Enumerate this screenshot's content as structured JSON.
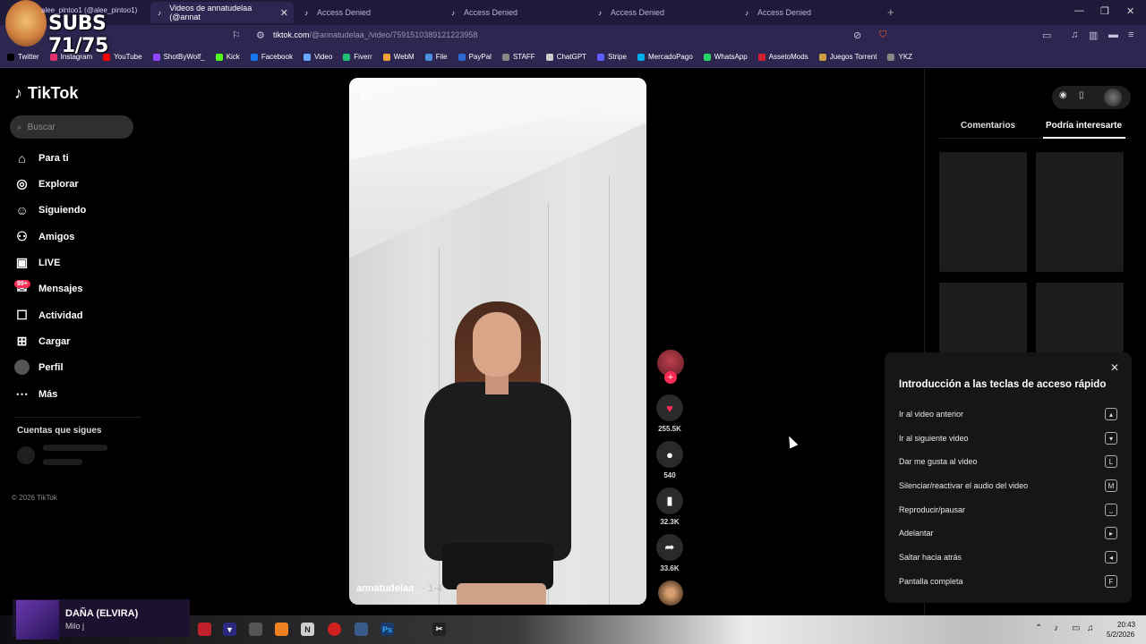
{
  "browser": {
    "tabs": [
      {
        "label": "Videos de annatudelaa (@annat"
      },
      {
        "label": "Access Denied"
      },
      {
        "label": "Access Denied"
      },
      {
        "label": "Access Denied"
      },
      {
        "label": "Access Denied"
      }
    ],
    "url_domain": "tiktok.com",
    "url_path": "/@annatudelaa_/video/7591510389121223958",
    "bookmarks": [
      {
        "label": "Twitter",
        "color": "#000000"
      },
      {
        "label": "Instagram",
        "color": "#e1306c"
      },
      {
        "label": "YouTube",
        "color": "#ff0000"
      },
      {
        "label": "ShotByWolf_",
        "color": "#9146ff"
      },
      {
        "label": "Kick",
        "color": "#53fc18"
      },
      {
        "label": "Facebook",
        "color": "#1877f2"
      },
      {
        "label": "Video",
        "color": "#6aa8ff"
      },
      {
        "label": "Fiverr",
        "color": "#1dbf73"
      },
      {
        "label": "WebM",
        "color": "#f2a33a"
      },
      {
        "label": "File",
        "color": "#4a90e2"
      },
      {
        "label": "PayPal",
        "color": "#2a6ad0"
      },
      {
        "label": "STAFF",
        "color": "#888888"
      },
      {
        "label": "ChatGPT",
        "color": "#cccccc"
      },
      {
        "label": "Stripe",
        "color": "#635bff"
      },
      {
        "label": "MercadoPago",
        "color": "#00b1ea"
      },
      {
        "label": "WhatsApp",
        "color": "#25d366"
      },
      {
        "label": "AssetoMods",
        "color": "#d02030"
      },
      {
        "label": "Juegos Torrent",
        "color": "#c8a040"
      },
      {
        "label": "YKZ",
        "color": "#888888"
      }
    ]
  },
  "overlay": {
    "subs": "SUBS 71/75",
    "tag": "alee_pintoo1 (@alee_pintoo1)"
  },
  "tiktok": {
    "logo": "TikTok",
    "search_placeholder": "Buscar",
    "nav": [
      {
        "label": "Para ti",
        "icon": "home-icon"
      },
      {
        "label": "Explorar",
        "icon": "compass-icon"
      },
      {
        "label": "Siguiendo",
        "icon": "following-icon"
      },
      {
        "label": "Amigos",
        "icon": "friends-icon"
      },
      {
        "label": "LIVE",
        "icon": "live-icon"
      },
      {
        "label": "Mensajes",
        "icon": "messages-icon"
      },
      {
        "label": "Actividad",
        "icon": "activity-icon"
      },
      {
        "label": "Cargar",
        "icon": "upload-icon"
      },
      {
        "label": "Perfil",
        "icon": "profile-icon"
      },
      {
        "label": "Más",
        "icon": "more-icon"
      }
    ],
    "messages_badge": "99+",
    "followed_title": "Cuentas que sigues",
    "copyright": "© 2026 TikTok"
  },
  "video": {
    "author": "annatudelaa_",
    "position": "· 1-4",
    "likes": "255.5K",
    "comments": "540",
    "saves": "32.3K",
    "shares": "33.6K",
    "accent": "#fe2c55"
  },
  "right_panel": {
    "tab_comments": "Comentarios",
    "tab_maybe": "Podría interesarte"
  },
  "shortcuts": {
    "title": "Introducción a las teclas de acceso rápido",
    "items": [
      {
        "label": "Ir al video anterior",
        "key": "▴"
      },
      {
        "label": "Ir al siguiente video",
        "key": "▾"
      },
      {
        "label": "Dar me gusta al video",
        "key": "L"
      },
      {
        "label": "Silenciar/reactivar el audio del video",
        "key": "M"
      },
      {
        "label": "Reproducir/pausar",
        "key": "⎵"
      },
      {
        "label": "Adelantar",
        "key": "▸"
      },
      {
        "label": "Saltar hacia atrás",
        "key": "◂"
      },
      {
        "label": "Pantalla completa",
        "key": "F"
      }
    ]
  },
  "now_playing": {
    "title": "DAÑA (ELVIRA)",
    "artist": "Milo j"
  },
  "taskbar": {
    "time": "20:43",
    "date": "5/2/2026"
  }
}
